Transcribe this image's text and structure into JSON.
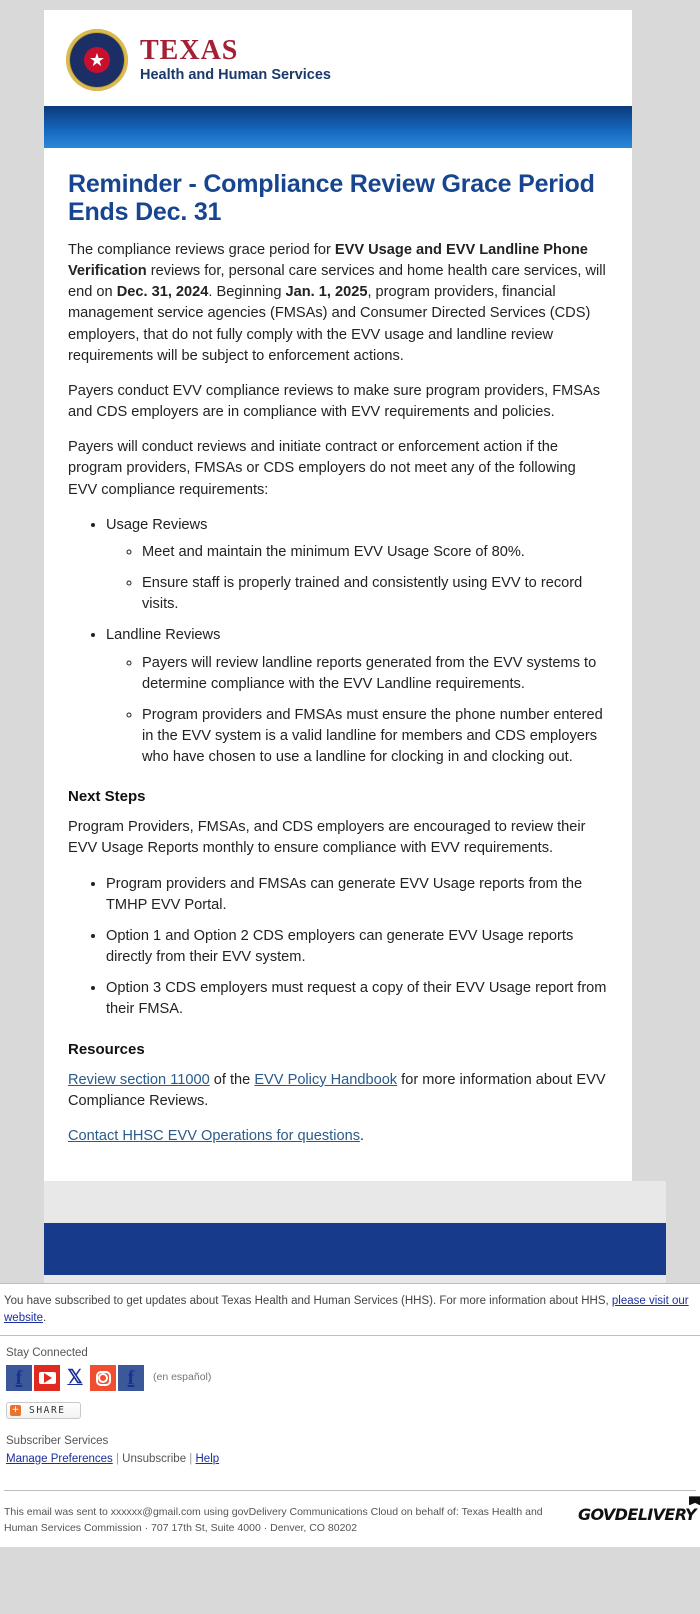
{
  "brand": {
    "logo_primary": "TEXAS",
    "logo_secondary": "Health and Human Services",
    "seal_icon": "texas-state-seal"
  },
  "email": {
    "headline": "Reminder - Compliance Review Grace Period Ends Dec. 31",
    "para1": {
      "s1": "The compliance reviews grace period for ",
      "b1": "EVV Usage and EVV Landline Phone Verification",
      "s2": " reviews for, personal care services and home health care services, will end on ",
      "b2": "Dec. 31, 2024",
      "s3": ". Beginning ",
      "b3": "Jan. 1, 2025",
      "s4": ", program providers, financial management service agencies (FMSAs) and Consumer Directed Services (CDS) employers, that do not fully comply with the EVV usage and landline review requirements will be subject to enforcement actions."
    },
    "para2": "Payers conduct EVV compliance reviews to make sure program providers, FMSAs and CDS employers are in compliance with EVV requirements and policies.",
    "para3": "Payers will conduct reviews and initiate contract or enforcement action if the program providers, FMSAs or CDS employers do not meet any of the following EVV compliance requirements:",
    "requirements": [
      {
        "label": "Usage Reviews",
        "sub": [
          "Meet and maintain the minimum EVV Usage Score of 80%.",
          "Ensure staff is properly trained and consistently using EVV to record visits."
        ]
      },
      {
        "label": "Landline Reviews",
        "sub": [
          "Payers will review landline reports generated from the EVV systems to determine compliance with the EVV Landline requirements.",
          "Program providers and FMSAs must ensure the phone number entered in the EVV system is a valid landline for members and CDS employers who have chosen to use a landline for clocking in and clocking out."
        ]
      }
    ],
    "next_steps_heading": "Next Steps",
    "next_steps_para": "Program Providers, FMSAs, and CDS employers are encouraged to review their EVV Usage Reports monthly to ensure compliance with EVV requirements.",
    "next_steps_items": [
      "Program providers and FMSAs can generate EVV Usage reports from the TMHP EVV Portal.",
      "Option 1 and Option 2 CDS employers can generate EVV Usage reports directly from their EVV system.",
      "Option 3 CDS employers must request a copy of their EVV Usage report from their FMSA."
    ],
    "resources_heading": "Resources",
    "resources_line": {
      "link1": "Review section 11000",
      "mid": " of the ",
      "link2": "EVV Policy Handbook",
      "tail": " for more information about EVV Compliance Reviews."
    },
    "contact_link": "Contact HHSC EVV Operations for questions",
    "contact_tail": "."
  },
  "footer": {
    "subscribe_note": {
      "text": "You have subscribed to get updates about Texas Health and Human Services (HHS). For more information about HHS, ",
      "link": "please visit our website",
      "tail": "."
    },
    "stay_connected": "Stay Connected",
    "social": [
      {
        "name": "facebook-icon",
        "label": "f"
      },
      {
        "name": "youtube-icon",
        "label": ""
      },
      {
        "name": "x-twitter-icon",
        "label": "𝕏"
      },
      {
        "name": "instagram-icon",
        "label": ""
      },
      {
        "name": "facebook-espanol-icon",
        "label": "f"
      }
    ],
    "espanol_note": "(en español)",
    "share_label": "SHARE",
    "subscriber_services": "Subscriber Services",
    "manage_preferences": "Manage Preferences",
    "unsubscribe": "Unsubscribe",
    "help": "Help",
    "sep": "|",
    "sent_notice": "This email was sent to xxxxxx@gmail.com using govDelivery Communications Cloud on behalf of: Texas Health and Human Services Commission · 707 17th St, Suite 4000 · Denver, CO 80202",
    "gov_logo": "GOVDELIVERY"
  },
  "colors": {
    "headline_blue": "#17458f",
    "brand_red": "#a32035",
    "brand_navy": "#1b3a6b",
    "footer_bar": "#173a8a",
    "link": "#2a5b8c"
  }
}
